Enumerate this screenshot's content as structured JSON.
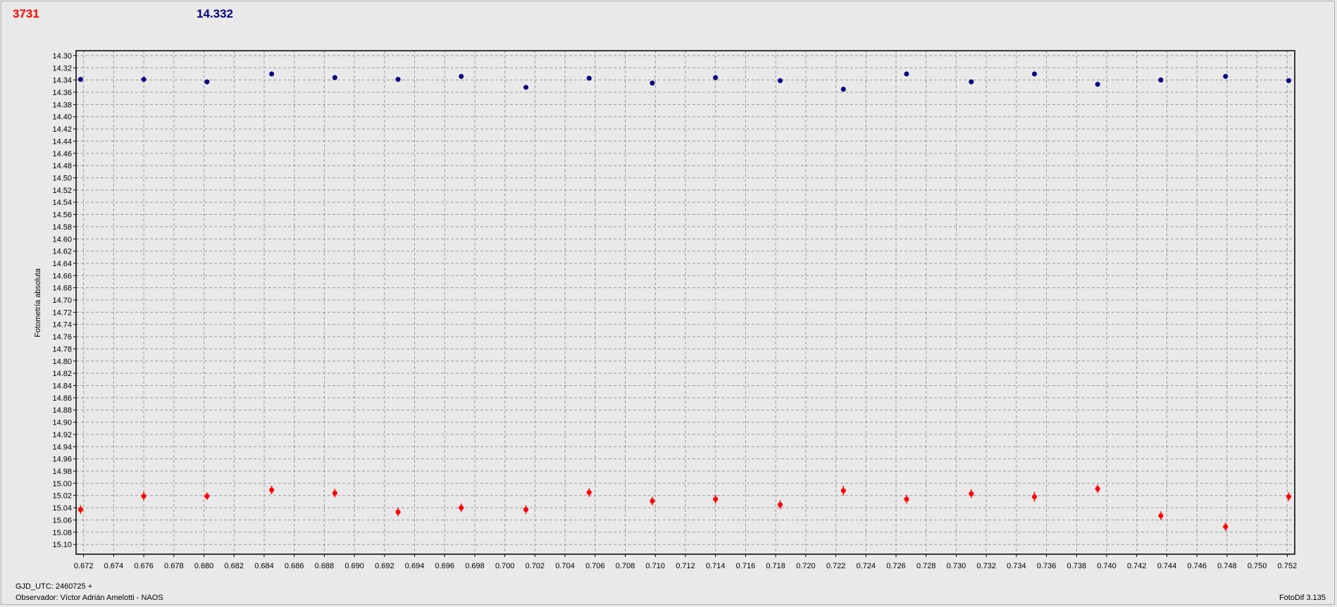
{
  "header": {
    "left_value": "3731",
    "right_value": "14.332",
    "left_color": "#ff0000",
    "right_color": "#000080"
  },
  "footer": {
    "gjd": "GJD_UTC: 2460725 +",
    "observer": "Observador: Víctor Adrián Amelotti - NAOS",
    "version": "FotoDif 3.135"
  },
  "chart_data": {
    "type": "scatter",
    "ylabel": "Fotometría absoluta",
    "xlim": [
      0.6715,
      0.7525
    ],
    "ylim": [
      14.292,
      15.116
    ],
    "y_inverted": true,
    "grid": true,
    "x_ticks": [
      "0.672",
      "0.674",
      "0.676",
      "0.678",
      "0.680",
      "0.682",
      "0.684",
      "0.686",
      "0.688",
      "0.690",
      "0.692",
      "0.694",
      "0.696",
      "0.698",
      "0.700",
      "0.702",
      "0.704",
      "0.706",
      "0.708",
      "0.710",
      "0.712",
      "0.714",
      "0.716",
      "0.718",
      "0.720",
      "0.722",
      "0.724",
      "0.726",
      "0.728",
      "0.730",
      "0.732",
      "0.734",
      "0.736",
      "0.738",
      "0.740",
      "0.742",
      "0.744",
      "0.746",
      "0.748",
      "0.750",
      "0.752"
    ],
    "y_ticks": [
      "14.30",
      "14.32",
      "14.34",
      "14.36",
      "14.38",
      "14.40",
      "14.42",
      "14.44",
      "14.46",
      "14.48",
      "14.50",
      "14.52",
      "14.54",
      "14.56",
      "14.58",
      "14.60",
      "14.62",
      "14.64",
      "14.66",
      "14.68",
      "14.70",
      "14.72",
      "14.74",
      "14.76",
      "14.78",
      "14.80",
      "14.82",
      "14.84",
      "14.86",
      "14.88",
      "14.90",
      "14.92",
      "14.94",
      "14.96",
      "14.98",
      "15.00",
      "15.02",
      "15.04",
      "15.06",
      "15.08",
      "15.10"
    ],
    "series": [
      {
        "color": "#000080",
        "x": [
          0.6718,
          0.676,
          0.6802,
          0.6845,
          0.6887,
          0.6929,
          0.6971,
          0.7014,
          0.7056,
          0.7098,
          0.714,
          0.7183,
          0.7225,
          0.7267,
          0.731,
          0.7352,
          0.7394,
          0.7436,
          0.7479,
          0.7521
        ],
        "y": [
          14.339,
          14.339,
          14.343,
          14.33,
          14.336,
          14.339,
          14.334,
          14.352,
          14.337,
          14.345,
          14.336,
          14.341,
          14.355,
          14.33,
          14.343,
          14.33,
          14.347,
          14.34,
          14.334,
          14.341
        ],
        "err": [
          0.004,
          0.004,
          0.004,
          0.004,
          0.004,
          0.004,
          0.004,
          0.004,
          0.004,
          0.004,
          0.004,
          0.004,
          0.004,
          0.004,
          0.004,
          0.004,
          0.004,
          0.004,
          0.004,
          0.004
        ]
      },
      {
        "color": "#ff0000",
        "x": [
          0.6718,
          0.676,
          0.6802,
          0.6845,
          0.6887,
          0.6929,
          0.6971,
          0.7014,
          0.7056,
          0.7098,
          0.714,
          0.7183,
          0.7225,
          0.7267,
          0.731,
          0.7352,
          0.7394,
          0.7436,
          0.7479,
          0.7521
        ],
        "y": [
          15.043,
          15.021,
          15.021,
          15.011,
          15.016,
          15.047,
          15.04,
          15.043,
          15.015,
          15.029,
          15.026,
          15.035,
          15.012,
          15.026,
          15.017,
          15.022,
          15.009,
          15.053,
          15.071,
          15.022
        ],
        "err": [
          0.007,
          0.007,
          0.006,
          0.007,
          0.007,
          0.007,
          0.007,
          0.007,
          0.007,
          0.007,
          0.007,
          0.007,
          0.008,
          0.007,
          0.007,
          0.008,
          0.007,
          0.007,
          0.007,
          0.007
        ]
      }
    ]
  }
}
